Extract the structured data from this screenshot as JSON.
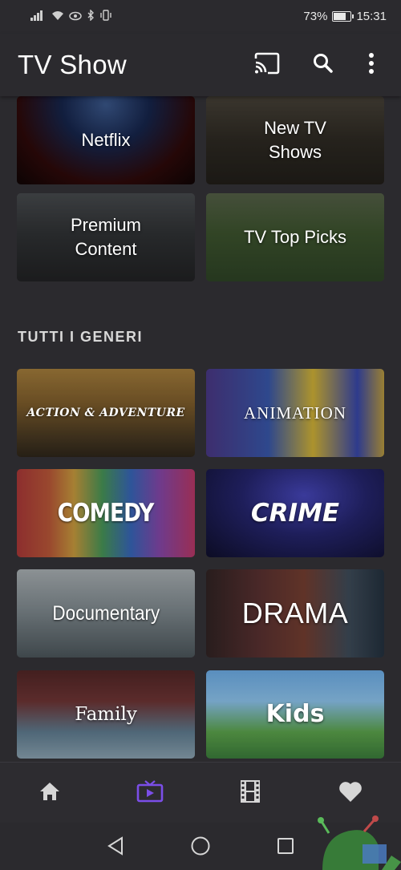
{
  "status_bar": {
    "battery": "73%",
    "battery_level": 0.73,
    "time": "15:31",
    "icons": [
      "signal-icon",
      "wifi-icon",
      "eye-icon",
      "bluetooth-icon",
      "vibrate-icon"
    ]
  },
  "app_bar": {
    "title": "TV Show",
    "actions": [
      "cast-icon",
      "search-icon",
      "more-vert-icon"
    ]
  },
  "featured": [
    {
      "label": "Netflix"
    },
    {
      "label": "New TV\nShows"
    },
    {
      "label": "Premium\nContent"
    },
    {
      "label": "TV Top Picks"
    }
  ],
  "genres_section": {
    "title": "TUTTI I GENERI",
    "items": [
      {
        "label": "ACTION & ADVENTURE"
      },
      {
        "label": "ANIMATION"
      },
      {
        "label": "COMEDY"
      },
      {
        "label": "CRIME"
      },
      {
        "label": "Documentary"
      },
      {
        "label": "DRAMA"
      },
      {
        "label": "Family"
      },
      {
        "label": "Kids"
      }
    ]
  },
  "bottom_nav": {
    "items": [
      "home-icon",
      "tv-icon",
      "film-icon",
      "heart-icon"
    ],
    "active_color": "#7b4ee8",
    "inactive_color": "#d6d6d6"
  },
  "system_nav": [
    "back-icon",
    "home-circle-icon",
    "recents-icon"
  ],
  "colors": {
    "background": "#2b2a2e",
    "accent": "#7b4ee8"
  }
}
